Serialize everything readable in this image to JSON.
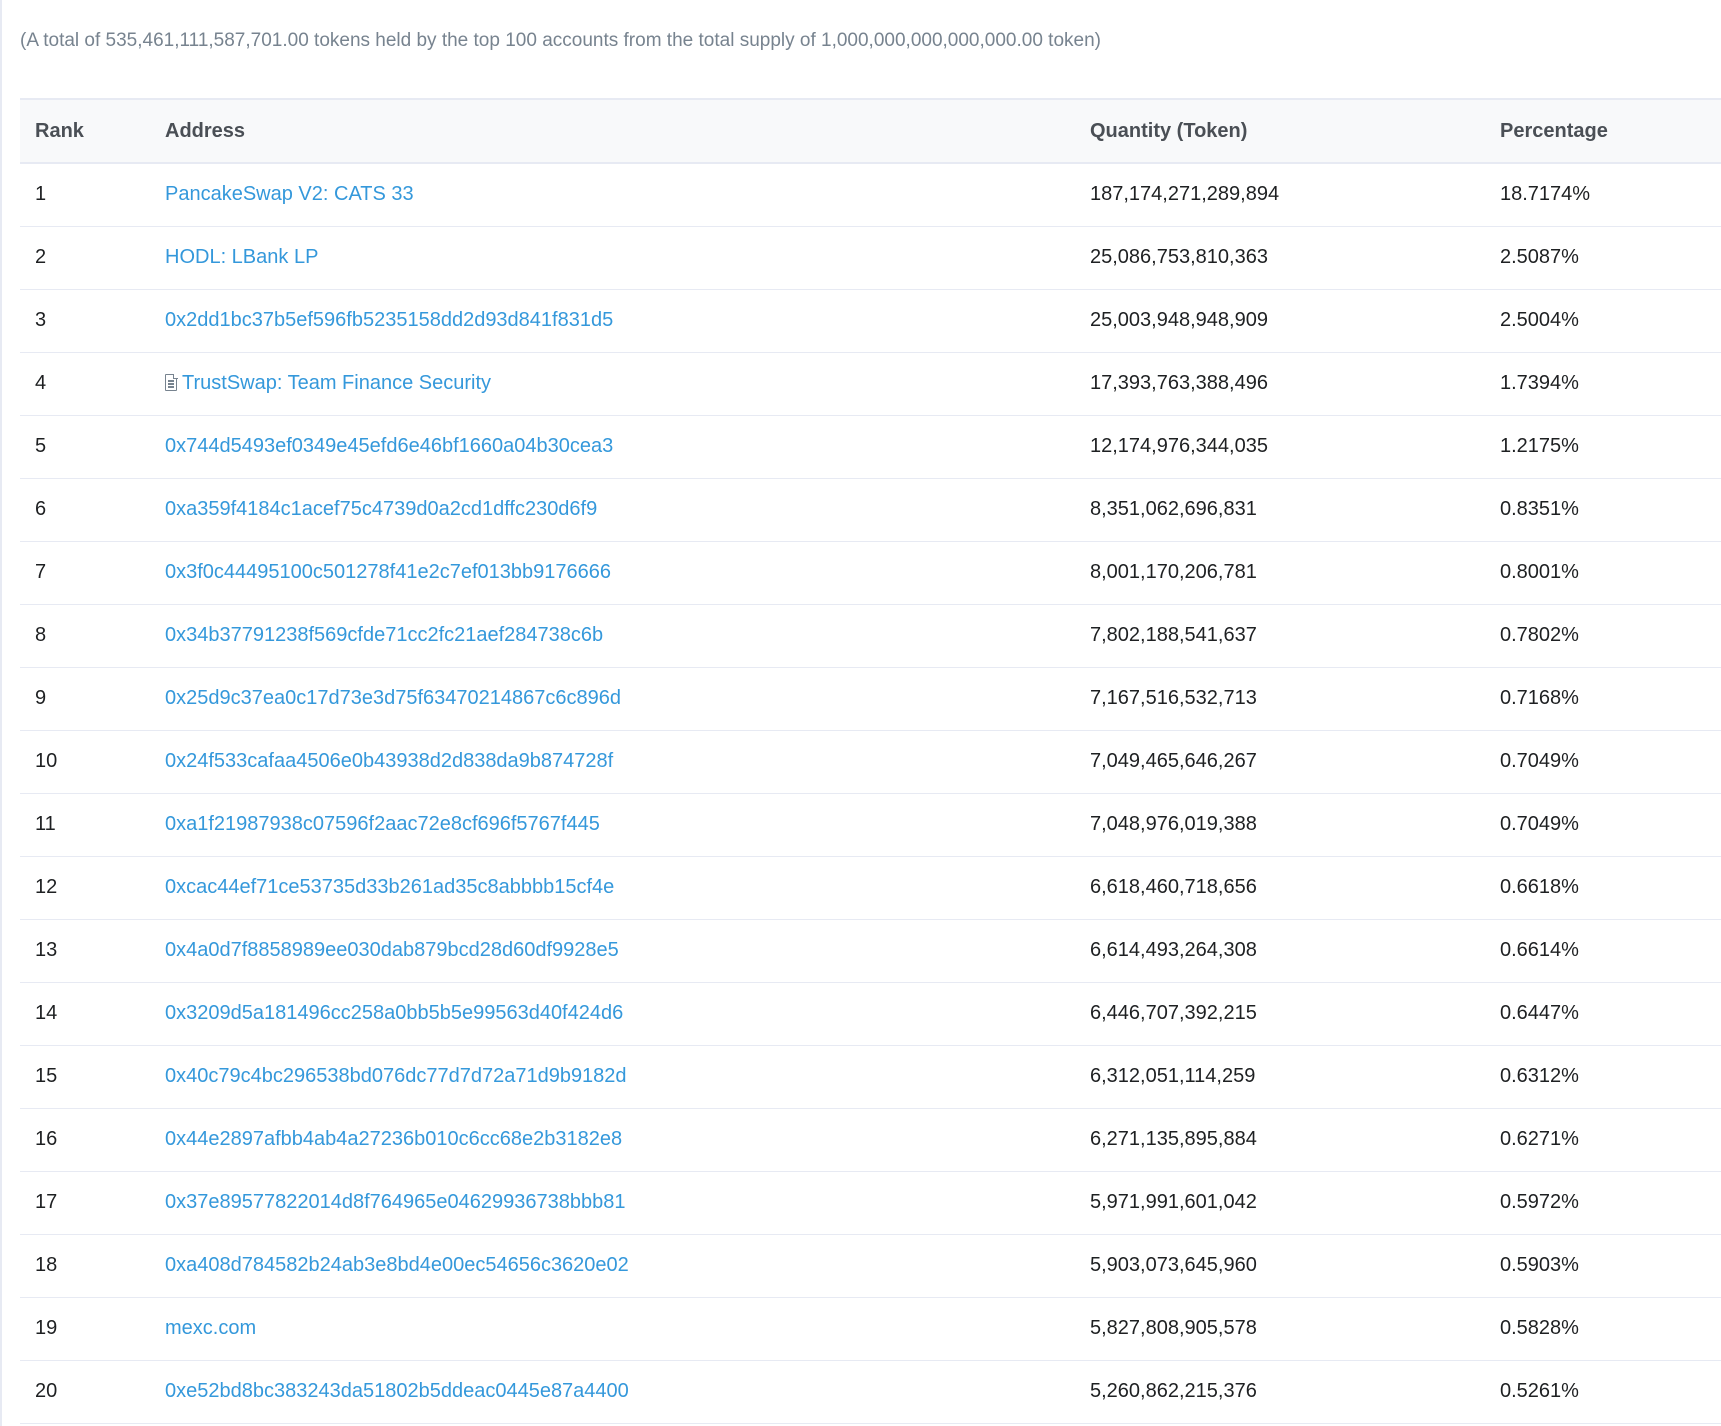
{
  "summary": "(A total of 535,461,111,587,701.00 tokens held by the top 100 accounts from the total supply of 1,000,000,000,000,000.00 token)",
  "columns": {
    "rank": "Rank",
    "address": "Address",
    "quantity": "Quantity (Token)",
    "percentage": "Percentage"
  },
  "rows": [
    {
      "rank": "1",
      "address": "PancakeSwap V2: CATS 33",
      "contract": false,
      "quantity": "187,174,271,289,894",
      "percentage": "18.7174%"
    },
    {
      "rank": "2",
      "address": "HODL: LBank LP",
      "contract": false,
      "quantity": "25,086,753,810,363",
      "percentage": "2.5087%"
    },
    {
      "rank": "3",
      "address": "0x2dd1bc37b5ef596fb5235158dd2d93d841f831d5",
      "contract": false,
      "quantity": "25,003,948,948,909",
      "percentage": "2.5004%"
    },
    {
      "rank": "4",
      "address": "TrustSwap: Team Finance Security",
      "contract": true,
      "icon": "contract-document-icon",
      "quantity": "17,393,763,388,496",
      "percentage": "1.7394%"
    },
    {
      "rank": "5",
      "address": "0x744d5493ef0349e45efd6e46bf1660a04b30cea3",
      "contract": false,
      "quantity": "12,174,976,344,035",
      "percentage": "1.2175%"
    },
    {
      "rank": "6",
      "address": "0xa359f4184c1acef75c4739d0a2cd1dffc230d6f9",
      "contract": false,
      "quantity": "8,351,062,696,831",
      "percentage": "0.8351%"
    },
    {
      "rank": "7",
      "address": "0x3f0c44495100c501278f41e2c7ef013bb9176666",
      "contract": false,
      "quantity": "8,001,170,206,781",
      "percentage": "0.8001%"
    },
    {
      "rank": "8",
      "address": "0x34b37791238f569cfde71cc2fc21aef284738c6b",
      "contract": false,
      "quantity": "7,802,188,541,637",
      "percentage": "0.7802%"
    },
    {
      "rank": "9",
      "address": "0x25d9c37ea0c17d73e3d75f63470214867c6c896d",
      "contract": false,
      "quantity": "7,167,516,532,713",
      "percentage": "0.7168%"
    },
    {
      "rank": "10",
      "address": "0x24f533cafaa4506e0b43938d2d838da9b874728f",
      "contract": false,
      "quantity": "7,049,465,646,267",
      "percentage": "0.7049%"
    },
    {
      "rank": "11",
      "address": "0xa1f21987938c07596f2aac72e8cf696f5767f445",
      "contract": false,
      "quantity": "7,048,976,019,388",
      "percentage": "0.7049%"
    },
    {
      "rank": "12",
      "address": "0xcac44ef71ce53735d33b261ad35c8abbbb15cf4e",
      "contract": false,
      "quantity": "6,618,460,718,656",
      "percentage": "0.6618%"
    },
    {
      "rank": "13",
      "address": "0x4a0d7f8858989ee030dab879bcd28d60df9928e5",
      "contract": false,
      "quantity": "6,614,493,264,308",
      "percentage": "0.6614%"
    },
    {
      "rank": "14",
      "address": "0x3209d5a181496cc258a0bb5b5e99563d40f424d6",
      "contract": false,
      "quantity": "6,446,707,392,215",
      "percentage": "0.6447%"
    },
    {
      "rank": "15",
      "address": "0x40c79c4bc296538bd076dc77d7d72a71d9b9182d",
      "contract": false,
      "quantity": "6,312,051,114,259",
      "percentage": "0.6312%"
    },
    {
      "rank": "16",
      "address": "0x44e2897afbb4ab4a27236b010c6cc68e2b3182e8",
      "contract": false,
      "quantity": "6,271,135,895,884",
      "percentage": "0.6271%"
    },
    {
      "rank": "17",
      "address": "0x37e89577822014d8f764965e04629936738bbb81",
      "contract": false,
      "quantity": "5,971,991,601,042",
      "percentage": "0.5972%"
    },
    {
      "rank": "18",
      "address": "0xa408d784582b24ab3e8bd4e00ec54656c3620e02",
      "contract": false,
      "quantity": "5,903,073,645,960",
      "percentage": "0.5903%"
    },
    {
      "rank": "19",
      "address": "mexc.com",
      "contract": false,
      "quantity": "5,827,808,905,578",
      "percentage": "0.5828%"
    },
    {
      "rank": "20",
      "address": "0xe52bd8bc383243da51802b5ddeac0445e87a4400",
      "contract": false,
      "quantity": "5,260,862,215,376",
      "percentage": "0.5261%"
    }
  ],
  "colors": {
    "link": "#3498db",
    "muted": "#77838f",
    "header_bg": "#f8f9fa",
    "border": "#e7eaf3"
  }
}
